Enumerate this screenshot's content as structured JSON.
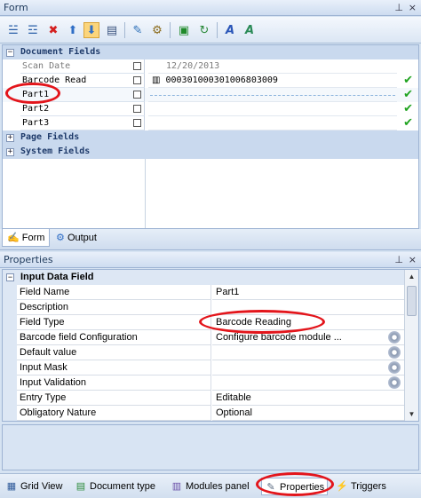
{
  "form_panel": {
    "title": "Form",
    "controls": [
      "⊥",
      "×"
    ]
  },
  "toolbar": {
    "buttons": [
      {
        "name": "add-field",
        "icon": "☱"
      },
      {
        "name": "add-subfield",
        "icon": "☲"
      },
      {
        "name": "delete",
        "icon": "✖"
      },
      {
        "name": "move-up",
        "icon": "⬆"
      },
      {
        "name": "move-down",
        "icon": "⬇"
      },
      {
        "name": "list",
        "icon": "▤"
      },
      {
        "name": "comment",
        "icon": "✎"
      },
      {
        "name": "settings",
        "icon": "⚙"
      },
      {
        "name": "select",
        "icon": "▣"
      },
      {
        "name": "refresh",
        "icon": "↻"
      },
      {
        "name": "font-a",
        "icon": "A"
      },
      {
        "name": "font-b",
        "icon": "A"
      }
    ]
  },
  "grid": {
    "document_group": "Document Fields",
    "rows": [
      {
        "label": "Scan Date",
        "value": "12/20/2013",
        "check": false
      },
      {
        "label": "Barcode Read",
        "value": "000301000301006803009",
        "check": true
      },
      {
        "label": "Part1",
        "value": "",
        "check": true
      },
      {
        "label": "Part2",
        "value": "",
        "check": true
      },
      {
        "label": "Part3",
        "value": "",
        "check": true
      }
    ],
    "page_group": "Page Fields",
    "system_group": "System Fields",
    "check_glyph": "✔"
  },
  "form_tabs": {
    "form": "Form",
    "output": "Output"
  },
  "properties_panel": {
    "title": "Properties",
    "section": "Input Data Field",
    "rows": [
      {
        "name": "Field Name",
        "value": "Part1",
        "gear": false
      },
      {
        "name": "Description",
        "value": "",
        "gear": false
      },
      {
        "name": "Field Type",
        "value": "Barcode Reading",
        "gear": false
      },
      {
        "name": "Barcode field Configuration",
        "value": "Configure barcode module ...",
        "gear": true
      },
      {
        "name": "Default value",
        "value": "",
        "gear": true
      },
      {
        "name": "Input Mask",
        "value": "",
        "gear": true
      },
      {
        "name": "Input Validation",
        "value": "",
        "gear": true
      },
      {
        "name": "Entry Type",
        "value": "Editable",
        "gear": false
      },
      {
        "name": "Obligatory Nature",
        "value": "Optional",
        "gear": false
      }
    ]
  },
  "bottom_tabs": {
    "grid_view": "Grid View",
    "document_type": "Document type",
    "modules_panel": "Modules panel",
    "properties": "Properties",
    "triggers": "Triggers"
  },
  "colors": {
    "highlight_oval": "#e3151b",
    "check_green": "#1fa31f"
  }
}
